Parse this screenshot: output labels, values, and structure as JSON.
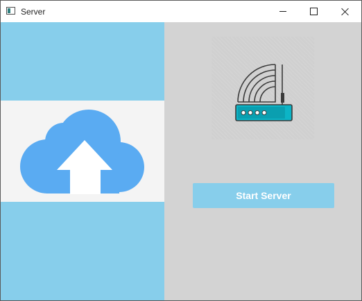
{
  "window": {
    "title": "Server",
    "app_icon": "window-app-icon",
    "controls": {
      "minimize_icon": "minimize-icon",
      "maximize_icon": "maximize-icon",
      "close_icon": "close-icon"
    }
  },
  "left_panel": {
    "background_color": "#87ceeb",
    "banner_color": "#f4f4f4",
    "illustration": "cloud-upload-icon",
    "illustration_color": "#5aabf2"
  },
  "right_panel": {
    "background_color": "#d3d3d3",
    "illustration": "wifi-router-icon",
    "start_button": {
      "label": "Start Server",
      "color": "#87ceeb",
      "text_color": "#ffffff"
    }
  }
}
